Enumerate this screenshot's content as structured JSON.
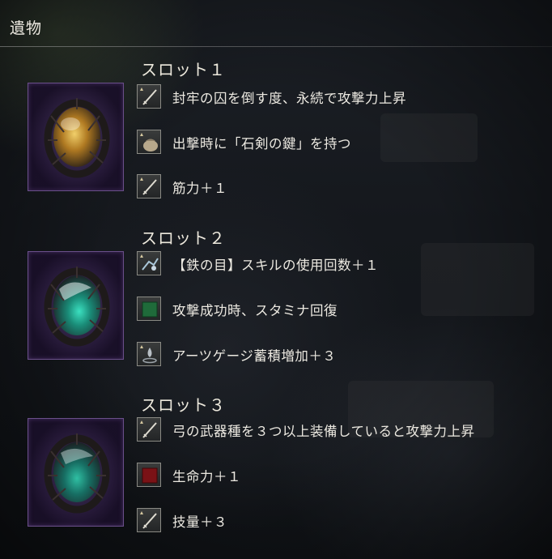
{
  "window": {
    "title": "遺物"
  },
  "slots": [
    {
      "title": "スロット１",
      "relic_name": "relic-gold",
      "effects": [
        {
          "icon": "sword-icon",
          "text": "封牢の囚を倒す度、永続で攻撃力上昇"
        },
        {
          "icon": "pouch-icon",
          "text": "出撃時に「石剣の鍵」を持つ"
        },
        {
          "icon": "sword-icon",
          "text": "筋力＋１"
        }
      ]
    },
    {
      "title": "スロット２",
      "relic_name": "relic-teal",
      "effects": [
        {
          "icon": "skill-icon",
          "text": "【鉄の目】スキルの使用回数＋１"
        },
        {
          "icon": "green-square-icon",
          "text": "攻撃成功時、スタミナ回復"
        },
        {
          "icon": "arts-icon",
          "text": "アーツゲージ蓄積増加＋３"
        }
      ]
    },
    {
      "title": "スロット３",
      "relic_name": "relic-teal-2",
      "effects": [
        {
          "icon": "sword-icon",
          "text": "弓の武器種を３つ以上装備していると攻撃力上昇"
        },
        {
          "icon": "red-square-icon",
          "text": "生命力＋１"
        },
        {
          "icon": "sword-icon",
          "text": "技量＋３"
        }
      ]
    }
  ],
  "colors": {
    "frame_border": "#6a4f8a",
    "gold_relic": "#c99a2e",
    "teal_relic": "#2fbfa3",
    "stat_green": "#1f6b3a",
    "stat_red": "#7a1216"
  }
}
